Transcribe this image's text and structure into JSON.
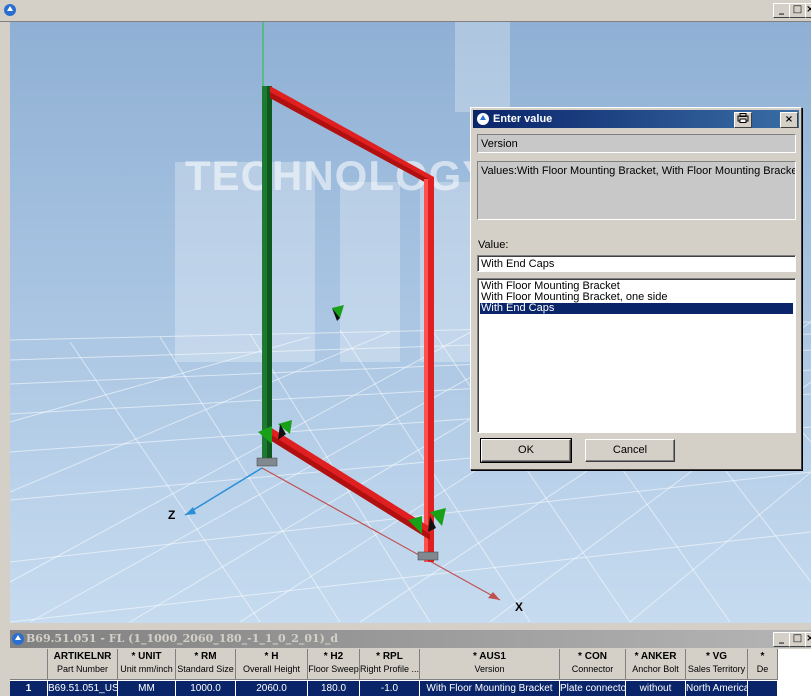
{
  "window": {
    "minimize": "_",
    "maximize": "□",
    "close": "×"
  },
  "viewport": {
    "watermark": "TECHNOLOGY",
    "axis_z": "Z",
    "axis_x": "X"
  },
  "dialog": {
    "title": "Enter value",
    "close": "×",
    "print_icon": "printer-icon",
    "field_name": "Version",
    "values_info": "Values:With Floor Mounting Bracket, With Floor Mounting Bracket, one sic",
    "value_label": "Value:",
    "value_input": "With End Caps",
    "options": [
      "With Floor Mounting Bracket",
      "With Floor Mounting Bracket, one side",
      "With End Caps"
    ],
    "selected_index": 2,
    "ok": "OK",
    "cancel": "Cancel"
  },
  "table": {
    "title": "B69.51.051 - FL (1_1000_2060_180_-1_1_0_2_01)_d",
    "columns": [
      {
        "code": "",
        "desc": ""
      },
      {
        "code": "ARTIKELNR",
        "desc": "Part Number"
      },
      {
        "code": "* UNIT",
        "desc": "Unit mm/inch"
      },
      {
        "code": "* RM",
        "desc": "Standard Size"
      },
      {
        "code": "* H",
        "desc": "Overall Height"
      },
      {
        "code": "* H2",
        "desc": "Floor Sweep"
      },
      {
        "code": "* RPL",
        "desc": "Right Profile ..."
      },
      {
        "code": "* AUS1",
        "desc": "Version"
      },
      {
        "code": "* CON",
        "desc": "Connector"
      },
      {
        "code": "* ANKER",
        "desc": "Anchor Bolt"
      },
      {
        "code": "* VG",
        "desc": "Sales Territory"
      },
      {
        "code": "*",
        "desc": "De"
      }
    ],
    "row": [
      "1",
      "B69.51.051_US",
      "MM",
      "1000.0",
      "2060.0",
      "180.0",
      "-1.0",
      "With Floor Mounting Bracket",
      "Plate connector",
      "without",
      "North America",
      ""
    ]
  }
}
